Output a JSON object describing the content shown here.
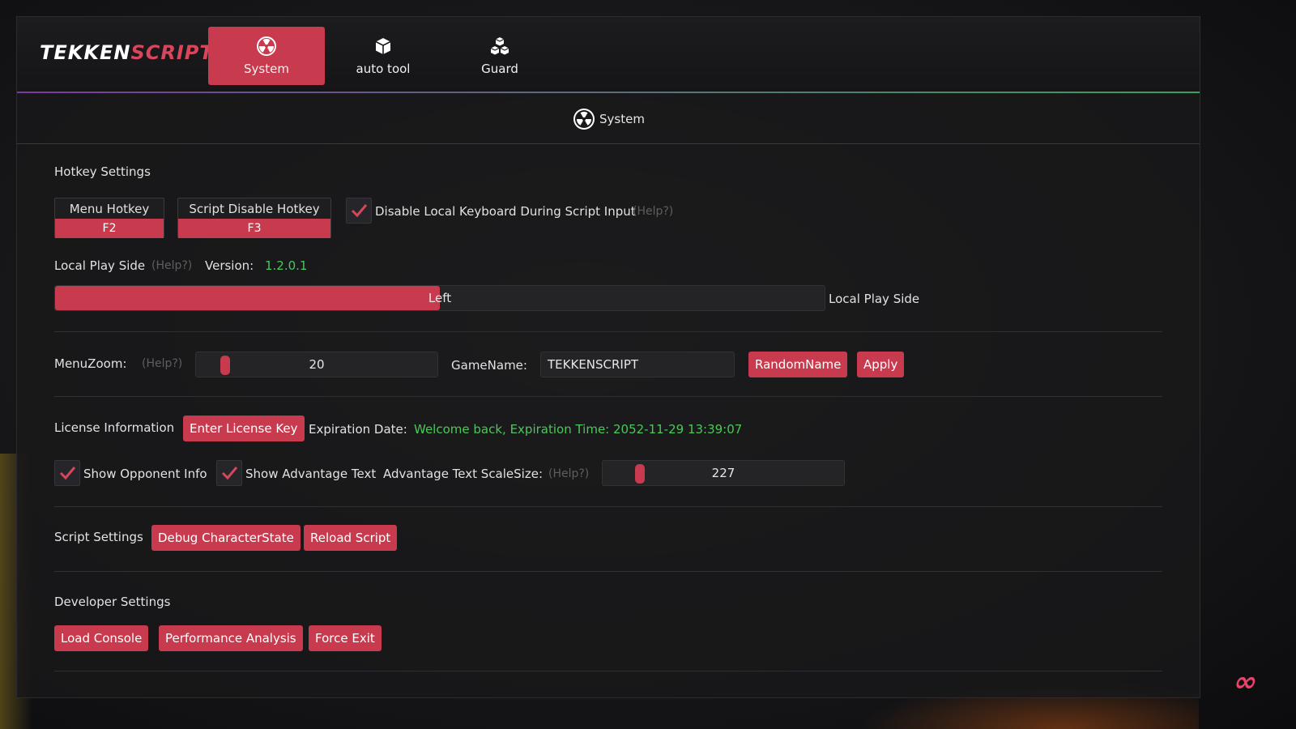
{
  "brand": {
    "part1": "TEKKEN",
    "part2": "SCRIPT"
  },
  "tabs": [
    {
      "label": "System",
      "icon": "radiation-icon",
      "active": true
    },
    {
      "label": "auto tool",
      "icon": "cube-icon",
      "active": false
    },
    {
      "label": "Guard",
      "icon": "cubes-icon",
      "active": false
    }
  ],
  "subheader": {
    "title": "System",
    "icon": "radiation-icon"
  },
  "hotkeys": {
    "section_title": "Hotkey Settings",
    "menu": {
      "label": "Menu Hotkey",
      "value": "F2"
    },
    "script_disable": {
      "label": "Script Disable Hotkey",
      "value": "F3"
    },
    "disable_keyboard": {
      "label": "Disable Local Keyboard During Script Input",
      "checked": true,
      "help": "(Help?)"
    }
  },
  "play_side": {
    "label": "Local Play Side",
    "help": "(Help?)",
    "version_label": "Version:",
    "version_value": "1.2.0.1",
    "bar_value": "Left",
    "bar_fill_fraction": 0.5,
    "bar_trailing_label": "Local Play Side"
  },
  "menu_zoom": {
    "label": "MenuZoom:",
    "help": "(Help?)",
    "value": "20",
    "game_name_label": "GameName:",
    "game_name_value": "TEKKENSCRIPT",
    "random_name_button": "RandomName",
    "apply_button": "Apply"
  },
  "license": {
    "label": "License Information",
    "enter_key_button": "Enter License Key",
    "expiration_label": "Expiration Date:",
    "expiration_value": "Welcome back, Expiration Time: 2052-11-29 13:39:07"
  },
  "display_options": {
    "show_opponent_info": {
      "label": "Show Opponent Info",
      "checked": true
    },
    "show_advantage_text": {
      "label": "Show Advantage Text",
      "checked": true
    },
    "scale_label": "Advantage Text ScaleSize:",
    "scale_help": "(Help?)",
    "scale_value": "227"
  },
  "script_settings": {
    "label": "Script Settings",
    "debug_button": "Debug CharacterState",
    "reload_button": "Reload Script"
  },
  "developer": {
    "label": "Developer Settings",
    "load_console_button": "Load Console",
    "performance_button": "Performance Analysis",
    "force_exit_button": "Force Exit"
  },
  "colors": {
    "accent": "#c83a4e",
    "success": "#4cc75a",
    "help": "#5e5e62"
  }
}
